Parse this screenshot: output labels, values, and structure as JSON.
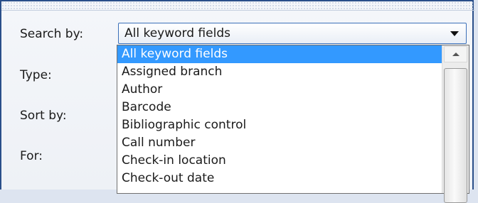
{
  "form": {
    "search_by_label": "Search by:",
    "type_label": "Type:",
    "sort_by_label": "Sort by:",
    "for_label": "For:"
  },
  "search_by": {
    "selected_value": "All keyword fields",
    "options": [
      "All keyword fields",
      "Assigned branch",
      "Author",
      "Barcode",
      "Bibliographic control",
      "Call number",
      "Check-in location",
      "Check-out date"
    ],
    "highlighted_index": 0
  },
  "icons": {
    "combo_arrow": "chevron-down-icon",
    "scroll_up": "arrow-up-icon"
  },
  "colors": {
    "highlight": "#3399ff",
    "frame_border": "#2a4f8a",
    "combo_border": "#3b6fb8"
  }
}
